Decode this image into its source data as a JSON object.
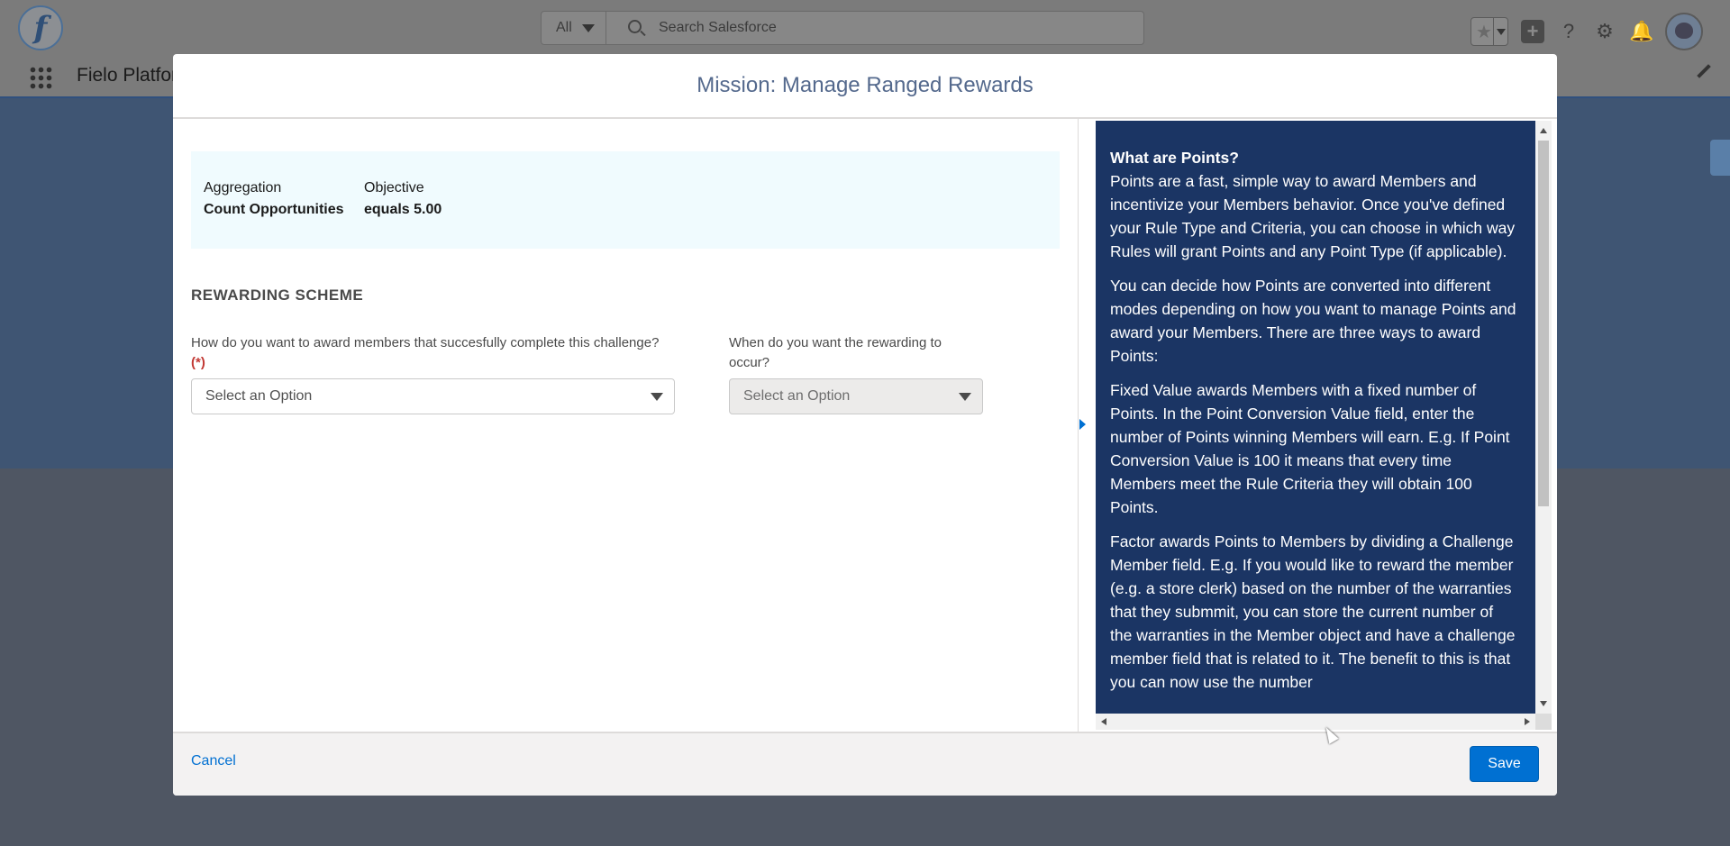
{
  "header": {
    "logo_text": "f",
    "search": {
      "scope": "All",
      "placeholder": "Search Salesforce"
    }
  },
  "nav": {
    "app_name": "Fielo Platform"
  },
  "modal": {
    "title": "Mission: Manage Ranged Rewards",
    "summary": {
      "aggregation_label": "Aggregation",
      "aggregation_value": "Count Opportunities",
      "objective_label": "Objective",
      "objective_value": "equals 5.00"
    },
    "section_title": "REWARDING SCHEME",
    "award_field": {
      "label": "How do you want to award members that succesfully complete this challenge?",
      "required_mark": "(*)",
      "value": "Select an Option"
    },
    "when_field": {
      "label": "When do you want the rewarding to occur?",
      "value": "Select an Option"
    },
    "help": {
      "heading": "What are Points?",
      "paragraphs": [
        "Points are a fast, simple way to award Members and incentivize your Members behavior. Once you've defined your Rule Type and Criteria, you can choose in which way Rules will grant Points and any Point Type (if applicable).",
        "You can decide how Points are converted into different modes depending on how you want to manage Points and award your Members. There are three ways to award Points:",
        "Fixed Value awards Members with a fixed number of Points. In the Point Conversion Value field, enter the number of Points winning Members will earn. E.g. If Point Conversion Value is 100 it means that every time Members meet the Rule Criteria they will obtain 100 Points.",
        "Factor awards Points to Members by dividing a Challenge Member field. E.g. If you would like to reward the member (e.g. a store clerk) based on the number of the warranties that they submmit, you can store the current number of the warranties in the Member object and have a challenge member field that is related to it. The benefit to this is that you can now use the number"
      ]
    },
    "footer": {
      "cancel_label": "Cancel",
      "save_label": "Save"
    }
  },
  "colors": {
    "brand_blue": "#0070d2",
    "help_panel_bg": "#1b3564",
    "summary_bg": "#f0fbfe",
    "required_red": "#c23934"
  }
}
